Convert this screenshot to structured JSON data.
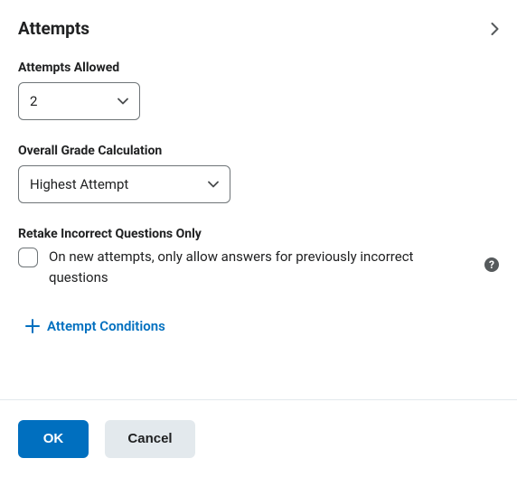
{
  "section": {
    "title": "Attempts"
  },
  "attemptsAllowed": {
    "label": "Attempts Allowed",
    "value": "2"
  },
  "gradeCalc": {
    "label": "Overall Grade Calculation",
    "value": "Highest Attempt"
  },
  "retake": {
    "groupLabel": "Retake Incorrect Questions Only",
    "description": "On new attempts, only allow answers for previously incorrect questions"
  },
  "helpGlyph": "?",
  "conditionsLink": "Attempt Conditions",
  "footer": {
    "ok": "OK",
    "cancel": "Cancel"
  }
}
